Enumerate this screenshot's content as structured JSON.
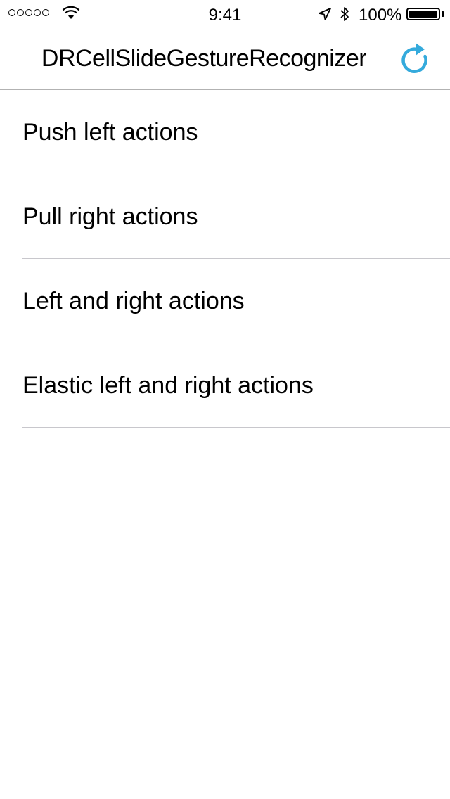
{
  "status_bar": {
    "time": "9:41",
    "battery_text": "100%",
    "battery_level": 1.0,
    "signal_icon": "signal-dots-icon",
    "wifi_icon": "wifi-icon",
    "location_icon": "location-arrow-icon",
    "bluetooth_icon": "bluetooth-icon"
  },
  "nav": {
    "title": "DRCellSlideGestureRecognizer",
    "refresh_icon": "refresh-icon",
    "accent_color": "#34AADC"
  },
  "rows": [
    {
      "label": "Push left actions"
    },
    {
      "label": "Pull right actions"
    },
    {
      "label": "Left and right actions"
    },
    {
      "label": "Elastic left and right actions"
    }
  ]
}
